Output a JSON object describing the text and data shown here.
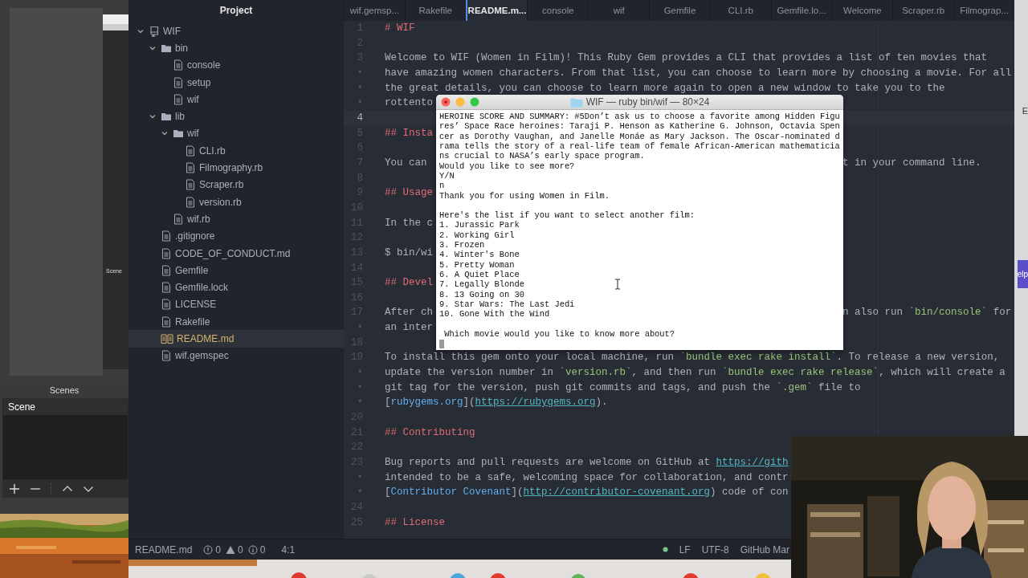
{
  "obs": {
    "preview_label": "Scene",
    "scenes_title": "Scenes",
    "scenes": [
      {
        "label": "Scene",
        "selected": true
      }
    ]
  },
  "project": {
    "title": "Project",
    "tree": [
      {
        "label": "WIF",
        "kind": "root",
        "expanded": true,
        "selected": false,
        "children": [
          {
            "label": "bin",
            "kind": "folder",
            "expanded": true,
            "selected": false,
            "children": [
              {
                "label": "console",
                "kind": "file",
                "selected": false
              },
              {
                "label": "setup",
                "kind": "file",
                "selected": false
              },
              {
                "label": "wif",
                "kind": "file",
                "selected": false
              }
            ]
          },
          {
            "label": "lib",
            "kind": "folder",
            "expanded": true,
            "selected": false,
            "children": [
              {
                "label": "wif",
                "kind": "folder",
                "expanded": true,
                "selected": false,
                "children": [
                  {
                    "label": "CLI.rb",
                    "kind": "file",
                    "selected": false
                  },
                  {
                    "label": "Filmography.rb",
                    "kind": "file",
                    "selected": false
                  },
                  {
                    "label": "Scraper.rb",
                    "kind": "file",
                    "selected": false
                  },
                  {
                    "label": "version.rb",
                    "kind": "file",
                    "selected": false
                  }
                ]
              },
              {
                "label": "wif.rb",
                "kind": "file",
                "selected": false
              }
            ]
          },
          {
            "label": ".gitignore",
            "kind": "file",
            "selected": false
          },
          {
            "label": "CODE_OF_CONDUCT.md",
            "kind": "file",
            "selected": false
          },
          {
            "label": "Gemfile",
            "kind": "file",
            "selected": false
          },
          {
            "label": "Gemfile.lock",
            "kind": "file",
            "selected": false
          },
          {
            "label": "LICENSE",
            "kind": "file",
            "selected": false
          },
          {
            "label": "Rakefile",
            "kind": "file",
            "selected": false
          },
          {
            "label": "README.md",
            "kind": "readme",
            "selected": true
          },
          {
            "label": "wif.gemspec",
            "kind": "file",
            "selected": false
          }
        ]
      }
    ]
  },
  "tabs": [
    {
      "label": "wif.gemsp...",
      "selected": false
    },
    {
      "label": "Rakefile",
      "selected": false
    },
    {
      "label": "README.m...",
      "selected": true
    },
    {
      "label": "console",
      "selected": false
    },
    {
      "label": "wif",
      "selected": false
    },
    {
      "label": "Gemfile",
      "selected": false
    },
    {
      "label": "CLI.rb",
      "selected": false
    },
    {
      "label": "Gemfile.lo...",
      "selected": false
    },
    {
      "label": "Welcome",
      "selected": false
    },
    {
      "label": "Scraper.rb",
      "selected": false
    },
    {
      "label": "Filmograp...",
      "selected": false
    }
  ],
  "editor": {
    "rows": [
      {
        "number": "1",
        "current": false,
        "tokens": [
          {
            "kind": "heading",
            "text": "# WIF"
          }
        ]
      },
      {
        "number": "2",
        "current": false
      },
      {
        "number": "3",
        "current": false,
        "tokens": [
          {
            "kind": "plain",
            "text": "Welcome to WIF (Women in Film)! This Ruby Gem provides a CLI that provides a list of ten movies that"
          }
        ]
      },
      {
        "number": "•",
        "current": false,
        "tokens": [
          {
            "kind": "plain",
            "text": "have amazing women characters. From that list, you can choose to learn more by choosing a movie. For all"
          }
        ]
      },
      {
        "number": "•",
        "current": false,
        "tokens": [
          {
            "kind": "plain",
            "text": "the great details, you can choose to learn more again to open a new window to take you to the"
          }
        ]
      },
      {
        "number": "•",
        "current": false,
        "tokens": [
          {
            "kind": "plain",
            "text": "rottento"
          }
        ]
      },
      {
        "number": "4",
        "current": true
      },
      {
        "number": "5",
        "current": false,
        "tokens": [
          {
            "kind": "heading",
            "text": "## Insta"
          }
        ]
      },
      {
        "number": "6",
        "current": false
      },
      {
        "number": "7",
        "current": false,
        "tokens": [
          {
            "kind": "plain",
            "text": "You can"
          }
        ],
        "right_tokens": [
          {
            "kind": "plain",
            "text": "t in your command line."
          }
        ]
      },
      {
        "number": "8",
        "current": false
      },
      {
        "number": "9",
        "current": false,
        "tokens": [
          {
            "kind": "heading",
            "text": "## Usage"
          }
        ]
      },
      {
        "number": "10",
        "current": false
      },
      {
        "number": "11",
        "current": false,
        "tokens": [
          {
            "kind": "plain",
            "text": "In the c"
          }
        ]
      },
      {
        "number": "12",
        "current": false
      },
      {
        "number": "13",
        "current": false,
        "tokens": [
          {
            "kind": "plain",
            "text": "$ bin/wi"
          }
        ]
      },
      {
        "number": "14",
        "current": false
      },
      {
        "number": "15",
        "current": false,
        "tokens": [
          {
            "kind": "heading",
            "text": "## Devel"
          }
        ]
      },
      {
        "number": "16",
        "current": false
      },
      {
        "number": "17",
        "current": false,
        "tokens": [
          {
            "kind": "plain",
            "text": "After ch"
          }
        ],
        "right_tokens": [
          {
            "kind": "plain",
            "text": "n also run "
          },
          {
            "kind": "code",
            "text": "`bin/console`"
          },
          {
            "kind": "plain",
            "text": " for"
          }
        ]
      },
      {
        "number": "•",
        "current": false,
        "tokens": [
          {
            "kind": "plain",
            "text": "an inter"
          }
        ]
      },
      {
        "number": "18",
        "current": false
      },
      {
        "number": "19",
        "current": false,
        "tokens": [
          {
            "kind": "plain",
            "text": "To install this gem onto your local machine, run "
          },
          {
            "kind": "code",
            "text": "`bundle exec rake install`"
          },
          {
            "kind": "plain",
            "text": ". To release a new version,"
          }
        ]
      },
      {
        "number": "•",
        "current": false,
        "tokens": [
          {
            "kind": "plain",
            "text": "update the version number in "
          },
          {
            "kind": "code",
            "text": "`version.rb`"
          },
          {
            "kind": "plain",
            "text": ", and then run "
          },
          {
            "kind": "code",
            "text": "`bundle exec rake release`"
          },
          {
            "kind": "plain",
            "text": ", which will create a"
          }
        ]
      },
      {
        "number": "•",
        "current": false,
        "tokens": [
          {
            "kind": "plain",
            "text": "git tag for the version, push git commits and tags, and push the "
          },
          {
            "kind": "code",
            "text": "`.gem`"
          },
          {
            "kind": "plain",
            "text": " file to"
          }
        ]
      },
      {
        "number": "•",
        "current": false,
        "tokens": [
          {
            "kind": "plain",
            "text": "["
          },
          {
            "kind": "link",
            "text": "rubygems.org"
          },
          {
            "kind": "plain",
            "text": "]("
          },
          {
            "kind": "url",
            "text": "https://rubygems.org"
          },
          {
            "kind": "plain",
            "text": ")."
          }
        ]
      },
      {
        "number": "20",
        "current": false
      },
      {
        "number": "21",
        "current": false,
        "tokens": [
          {
            "kind": "heading",
            "text": "## Contributing"
          }
        ]
      },
      {
        "number": "22",
        "current": false
      },
      {
        "number": "23",
        "current": false,
        "tokens": [
          {
            "kind": "plain",
            "text": "Bug reports and pull requests are welcome on GitHub at "
          },
          {
            "kind": "url",
            "text": "https://gith"
          }
        ]
      },
      {
        "number": "•",
        "current": false,
        "tokens": [
          {
            "kind": "plain",
            "text": "intended to be a safe, welcoming space for collaboration, and contr"
          }
        ]
      },
      {
        "number": "•",
        "current": false,
        "tokens": [
          {
            "kind": "plain",
            "text": "["
          },
          {
            "kind": "link",
            "text": "Contributor Covenant"
          },
          {
            "kind": "plain",
            "text": "]("
          },
          {
            "kind": "url",
            "text": "http://contributor-covenant.org"
          },
          {
            "kind": "plain",
            "text": ") code of con"
          }
        ]
      },
      {
        "number": "24",
        "current": false
      },
      {
        "number": "25",
        "current": false,
        "tokens": [
          {
            "kind": "heading",
            "text": "## License"
          }
        ]
      }
    ]
  },
  "status_bar": {
    "file": "README.md",
    "errors": "0",
    "warnings": "0",
    "infos": "0",
    "cursor": "4:1",
    "line_ending": "LF",
    "encoding": "UTF-8",
    "grammar": "GitHub Mar"
  },
  "terminal": {
    "title": "WIF — ruby bin/wif — 80×24",
    "blocks": [
      [
        "HEROINE SCORE AND SUMMARY: #5Don’t ask us to choose a favorite among Hidden Figu",
        "res’ Space Race heroines: Taraji P. Henson as Katherine G. Johnson, Octavia Spen",
        "cer as Dorothy Vaughan, and Janelle Monáe as Mary Jackson. The Oscar-nominated d",
        "rama tells the story of a real-life team of female African-American mathematicia",
        "ns crucial to NASA’s early space program.",
        "Would you like to see more?",
        "Y/N",
        "n",
        "Thank you for using Women in Film."
      ],
      [
        "Here's the list if you want to select another film:",
        "1. Jurassic Park",
        "2. Working Girl",
        "3. Frozen",
        "4. Winter's Bone",
        "5. Pretty Woman",
        "6. A Quiet Place",
        "7. Legally Blonde",
        "8. 13 Going on 30",
        "9. Star Wars: The Last Jedi",
        "10. Gone With the Wind"
      ],
      [
        " Which movie would you like to know more about?"
      ]
    ]
  },
  "right_edge": {
    "top_letter": "E",
    "button_fragment": "elp"
  }
}
